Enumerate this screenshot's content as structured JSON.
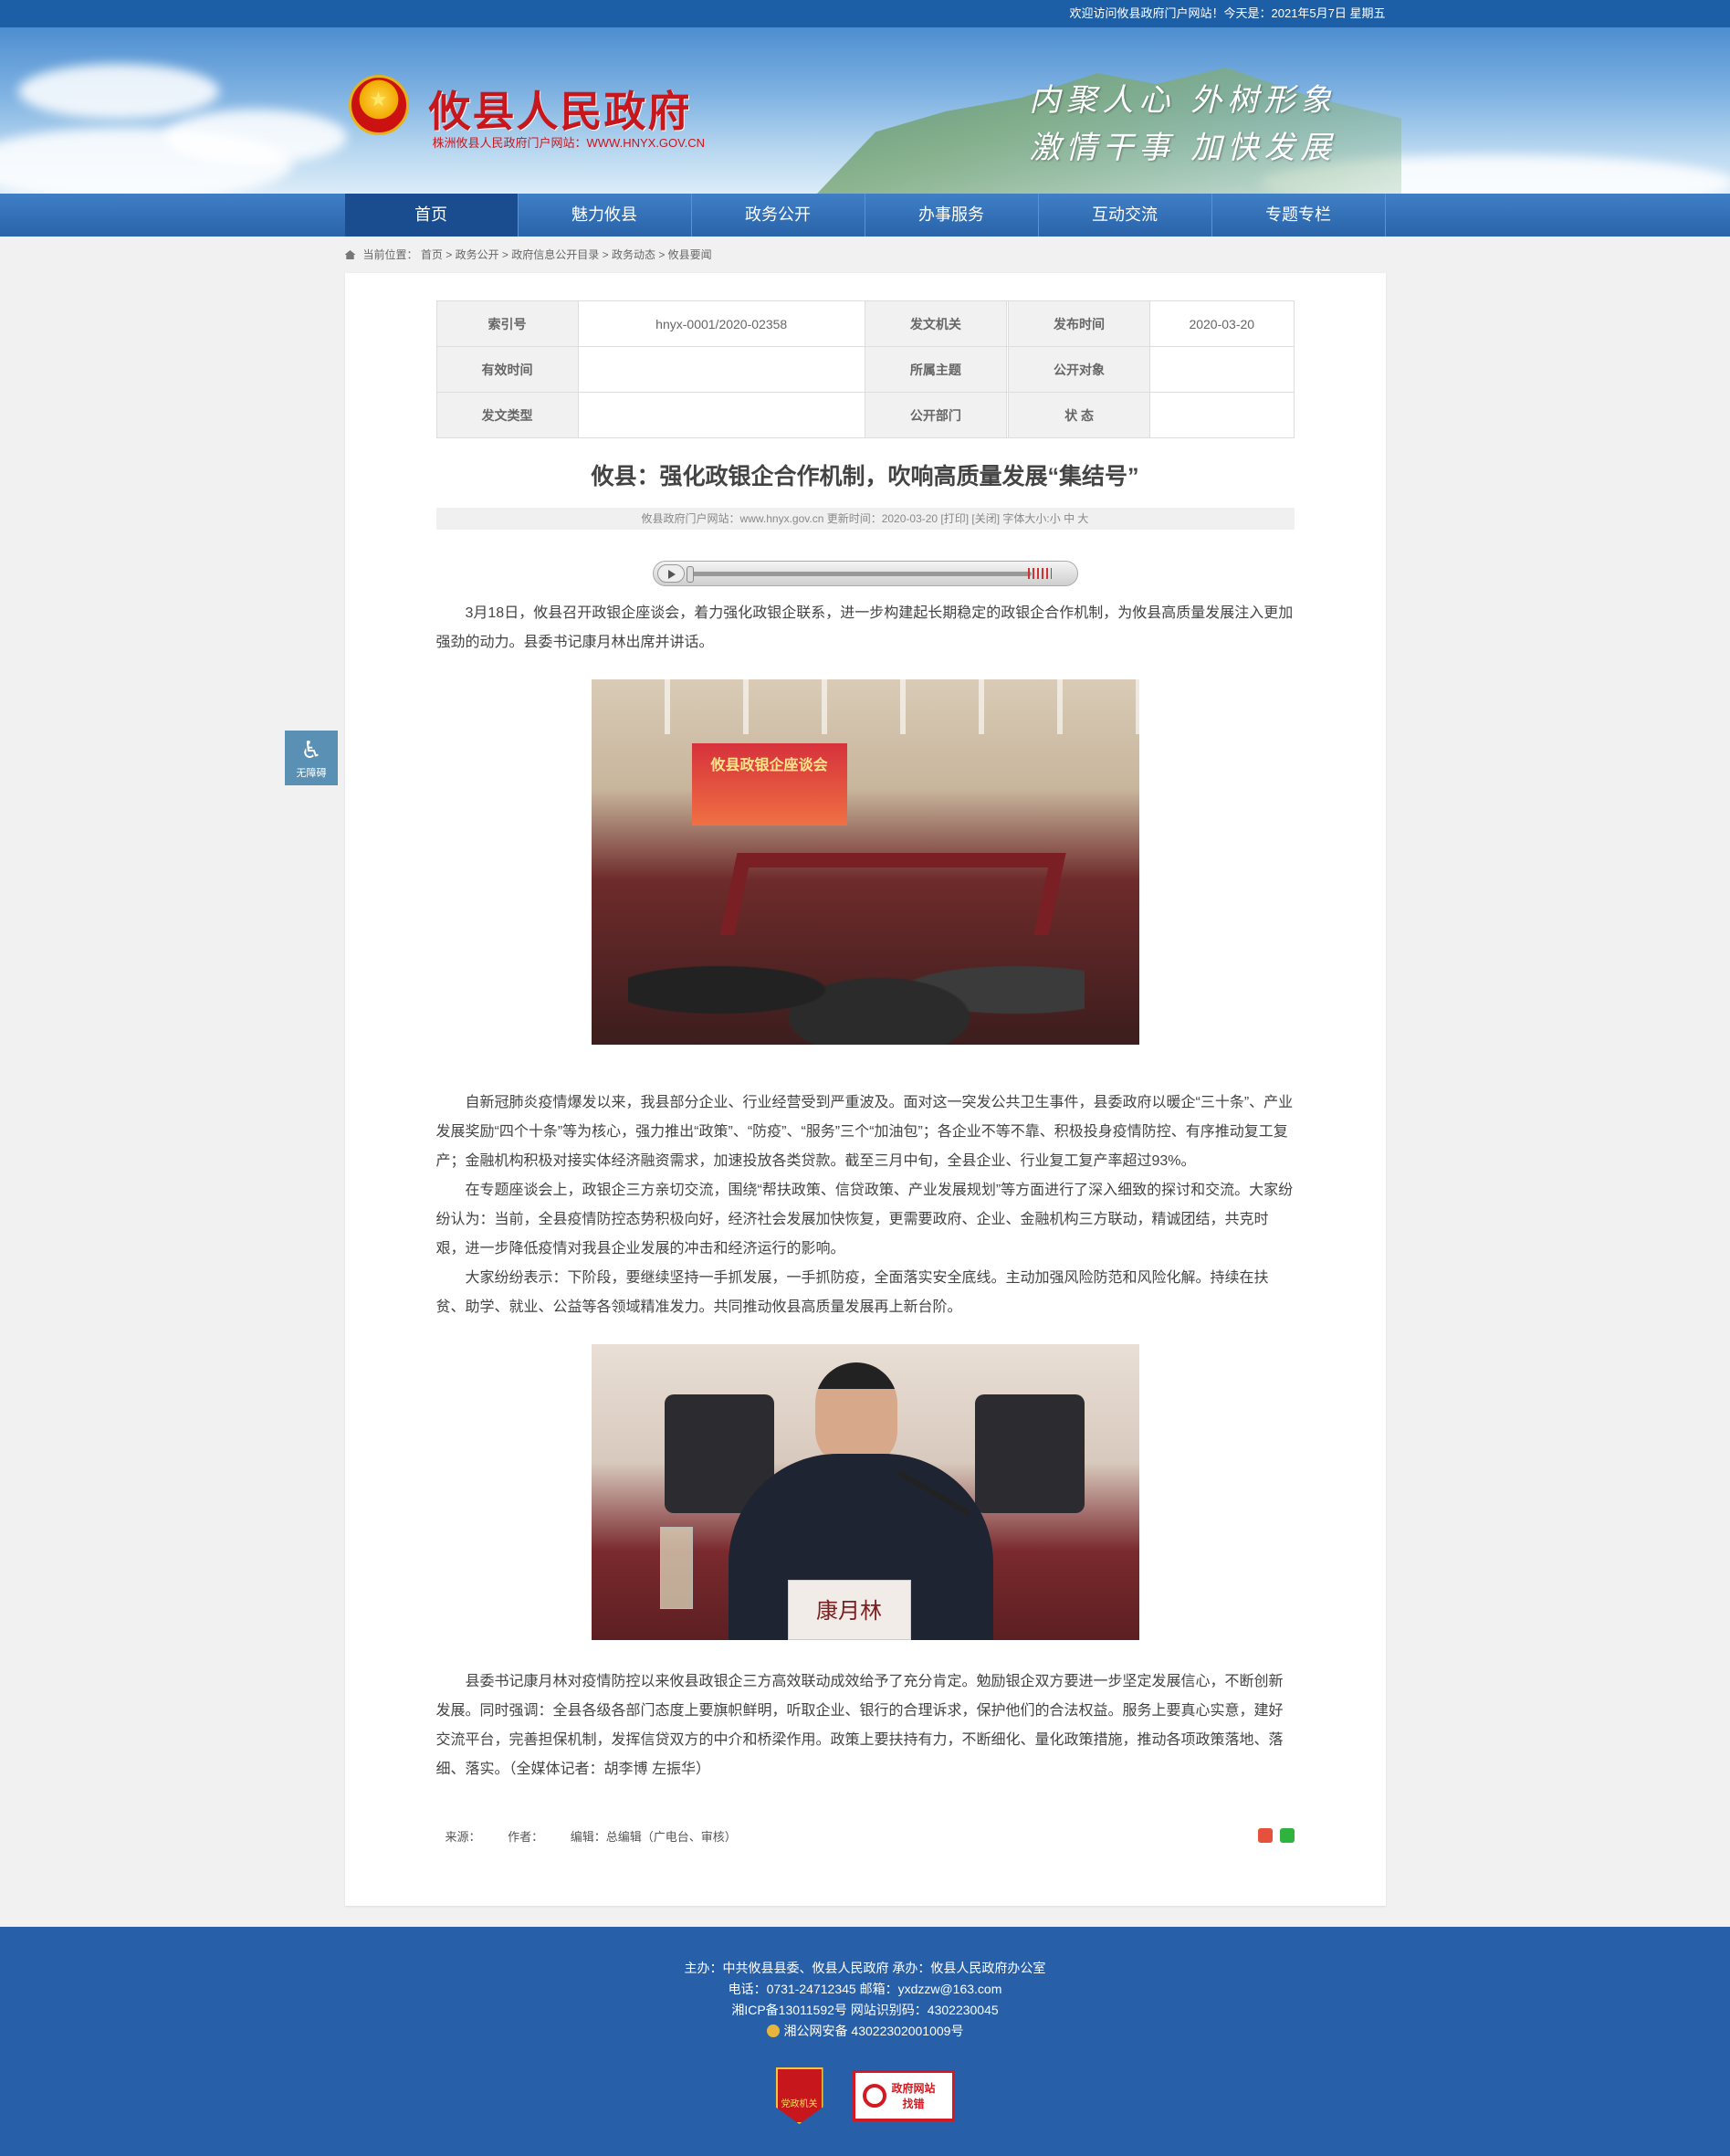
{
  "topbar": {
    "welcome": "欢迎访问攸县政府门户网站！今天是：2021年5月7日 星期五"
  },
  "header": {
    "site_name": "攸县人民政府",
    "site_url": "株洲攸县人民政府门户网站：WWW.HNYX.GOV.CN",
    "slogan1": "内聚人心 外树形象",
    "slogan2": "激情干事 加快发展"
  },
  "nav": {
    "items": [
      "首页",
      "魅力攸县",
      "政务公开",
      "办事服务",
      "互动交流",
      "专题专栏"
    ]
  },
  "breadcrumb": {
    "label": "当前位置：",
    "items": [
      "首页",
      "政务公开",
      "政府信息公开目录",
      "政务动态",
      "攸县要闻"
    ]
  },
  "meta_table": {
    "rows": [
      [
        {
          "k": "索引号",
          "v": "hnyx-0001/2020-02358"
        },
        {
          "k": "发文机关",
          "v": ""
        },
        {
          "k": "发布时间",
          "v": "2020-03-20"
        }
      ],
      [
        {
          "k": "有效时间",
          "v": ""
        },
        {
          "k": "所属主题",
          "v": ""
        },
        {
          "k": "公开对象",
          "v": ""
        }
      ],
      [
        {
          "k": "发文类型",
          "v": ""
        },
        {
          "k": "公开部门",
          "v": ""
        },
        {
          "k": "状 态",
          "v": ""
        }
      ]
    ]
  },
  "article": {
    "title": "攸县：强化政银企合作机制，吹响高质量发展“集结号”",
    "info": "攸县政府门户网站：www.hnyx.gov.cn  更新时间：2020-03-20  [打印] [关闭]  字体大小:小 中 大",
    "p1": "3月18日，攸县召开政银企座谈会，着力强化政银企联系，进一步构建起长期稳定的政银企合作机制，为攸县高质量发展注入更加强劲的动力。县委书记康月林出席并讲话。",
    "p2": "自新冠肺炎疫情爆发以来，我县部分企业、行业经营受到严重波及。面对这一突发公共卫生事件，县委政府以暖企“三十条”、产业发展奖励“四个十条”等为核心，强力推出“政策”、“防疫”、“服务”三个“加油包”；各企业不等不靠、积极投身疫情防控、有序推动复工复产；金融机构积极对接实体经济融资需求，加速投放各类贷款。截至三月中旬，全县企业、行业复工复产率超过93%。",
    "p3": "在专题座谈会上，政银企三方亲切交流，围绕“帮扶政策、信贷政策、产业发展规划”等方面进行了深入细致的探讨和交流。大家纷纷认为：当前，全县疫情防控态势积极向好，经济社会发展加快恢复，更需要政府、企业、金融机构三方联动，精诚团结，共克时艰，进一步降低疫情对我县企业发展的冲击和经济运行的影响。",
    "p4": "大家纷纷表示：下阶段，要继续坚持一手抓发展，一手抓防疫，全面落实安全底线。主动加强风险防范和风险化解。持续在扶贫、助学、就业、公益等各领域精准发力。共同推动攸县高质量发展再上新台阶。",
    "p5": "县委书记康月林对疫情防控以来攸县政银企三方高效联动成效给予了充分肯定。勉励银企双方要进一步坚定发展信心，不断创新发展。同时强调：全县各级各部门态度上要旗帜鲜明，听取企业、银行的合理诉求，保护他们的合法权益。服务上要真心实意，建好交流平台，完善担保机制，发挥信贷双方的中介和桥梁作用。政策上要扶持有力，不断细化、量化政策措施，推动各项政策落地、落细、落实。（全媒体记者：胡李博 左振华）",
    "photo1_screen": "攸县政银企座谈会",
    "photo2_nameplate": "康月林",
    "source_label": "来源：",
    "author_label": "作者：",
    "editor_label": "编辑：总编辑（广电台、审核）"
  },
  "accessibility": {
    "label": "无障碍"
  },
  "footer": {
    "line1": "主办：中共攸县县委、攸县人民政府 承办：攸县人民政府办公室",
    "line2": "电话：0731-24712345 邮箱：yxdzzw@163.com",
    "line3": "湘ICP备13011592号    网站识别码：4302230045",
    "line4": "湘公网安备 43022302001009号",
    "badge1": "党政机关",
    "badge2_top": "政府网站",
    "badge2_bottom": "找错"
  },
  "colors": {
    "topbar": "#1d5fa6",
    "nav": "#2a63a9",
    "nav_active": "#1a4d8f",
    "footer": "#2760a8",
    "brand_red": "#c8161d"
  }
}
